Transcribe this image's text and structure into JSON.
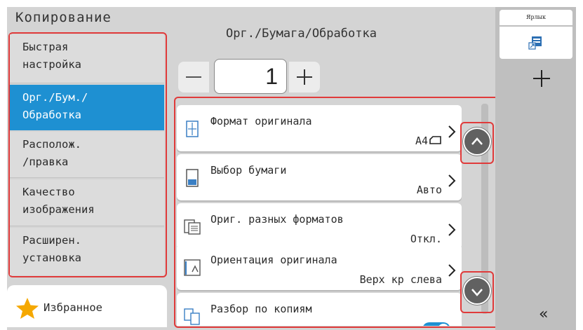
{
  "app": {
    "title": "Копирование"
  },
  "sidebar": {
    "items": [
      {
        "label": "Быстрая\nнастройка",
        "active": false
      },
      {
        "label": "Орг./Бум./\nОбработка",
        "active": true
      },
      {
        "label": "Располож.\n/правка",
        "active": false
      },
      {
        "label": "Качество\nизображения",
        "active": false
      },
      {
        "label": "Расширен.\nустановка",
        "active": false
      }
    ],
    "favorites_label": "Избранное"
  },
  "main": {
    "title": "Орг./Бумага/Обработка",
    "copies": "1",
    "rows": [
      {
        "label": "Формат оригинала",
        "value": "A4",
        "icon": "original-size-icon"
      },
      {
        "label": "Выбор бумаги",
        "value": "Авто",
        "icon": "paper-selection-icon"
      },
      {
        "label": "Ориг. разных форматов",
        "value": "Откл.",
        "icon": "mixed-size-originals-icon"
      },
      {
        "label": "Ориентация оригинала",
        "value": "Верх кр слева",
        "icon": "original-orientation-icon"
      },
      {
        "label": "Разбор по копиям",
        "value_on": true,
        "icon": "collate-icon"
      }
    ]
  },
  "right_panel": {
    "shortcut_label": "Ярлык",
    "collapse_glyph": "«"
  },
  "colors": {
    "accent": "#1e90d2",
    "highlight": "#e03a3a",
    "panel": "#d4d4d4",
    "scroll": "#616161"
  }
}
